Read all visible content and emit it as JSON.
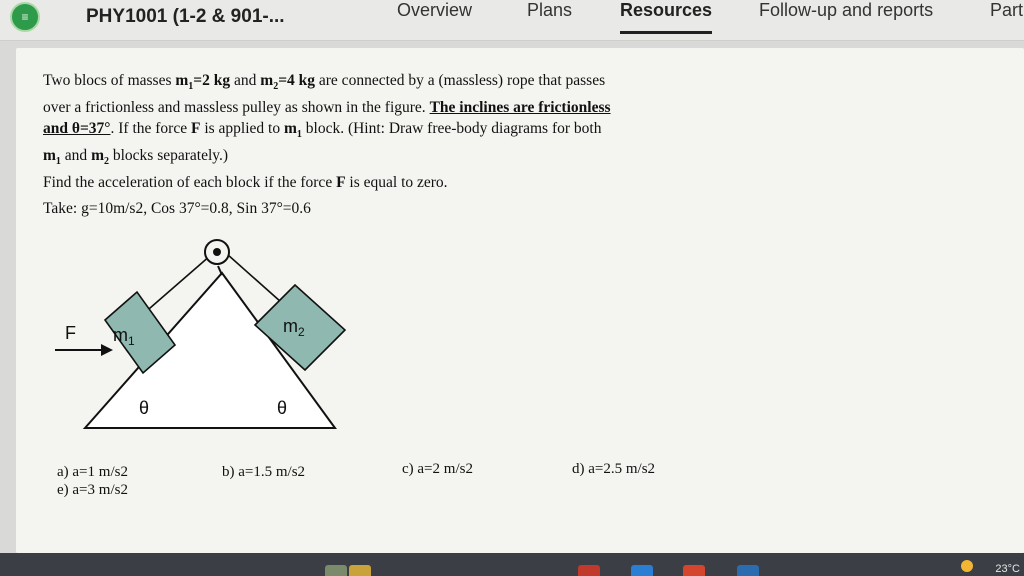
{
  "header": {
    "course_title": "PHY1001 (1-2 & 901-...",
    "tabs": [
      {
        "label": "Overview"
      },
      {
        "label": "Plans"
      },
      {
        "label": "Resources",
        "active": true
      },
      {
        "label": "Follow-up and reports"
      },
      {
        "label": "Part"
      }
    ]
  },
  "question": {
    "line1_a": "Two blocs of masses ",
    "m1": "m",
    "m1_sub": "1",
    "m1_eq": "=2 kg",
    "line1_b": " and ",
    "m2": "m",
    "m2_sub": "2",
    "m2_eq": "=4 kg",
    "line1_c": " are connected by a (massless) rope that passes",
    "line2_a": "over a frictionless and massless pulley as shown in the figure. ",
    "line2_b": "The inclines are frictionless",
    "line3_a": "and θ=37°",
    "line3_b": ". If the force ",
    "line3_F": "F",
    "line3_c": " is applied to ",
    "line3_m": "m",
    "line3_sub": "1",
    "line3_d": " block. (Hint: Draw free-body diagrams for both",
    "line4_m1": "m",
    "line4_sub1": "1",
    "line4_and": " and ",
    "line4_m2": "m",
    "line4_sub2": "2",
    "line4_rest": " blocks separately.)",
    "line5_a": "Find the acceleration of each block if the force ",
    "line5_F": "F",
    "line5_b": " is equal to zero.",
    "take": "Take: g=10m/s2, Cos 37°=0.8, Sin 37°=0.6"
  },
  "figure": {
    "force_label": "F",
    "m1_label": "m",
    "m1_sub": "1",
    "m2_label": "m",
    "m2_sub": "2",
    "angle_left": "θ",
    "angle_right": "θ",
    "block_color": "#8fb9b0"
  },
  "options": [
    {
      "label": "a) a=1 m/s2"
    },
    {
      "label": "b) a=1.5 m/s2"
    },
    {
      "label": "c) a=2 m/s2"
    },
    {
      "label": "d) a=2.5 m/s2"
    },
    {
      "label": "e) a=3 m/s2"
    }
  ],
  "taskbar": {
    "temperature": "23°C"
  }
}
